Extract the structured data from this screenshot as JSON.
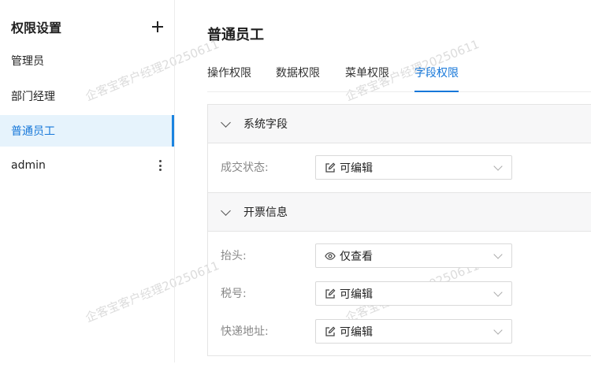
{
  "sidebar": {
    "title": "权限设置",
    "add_icon": "plus-icon",
    "items": [
      {
        "label": "管理员",
        "active": false
      },
      {
        "label": "部门经理",
        "active": false
      },
      {
        "label": "普通员工",
        "active": true
      },
      {
        "label": "admin",
        "active": false,
        "more_icon": "more-vertical-icon"
      }
    ]
  },
  "main": {
    "title": "普通员工",
    "tabs": [
      {
        "label": "操作权限",
        "active": false
      },
      {
        "label": "数据权限",
        "active": false
      },
      {
        "label": "菜单权限",
        "active": false
      },
      {
        "label": "字段权限",
        "active": true
      }
    ],
    "sections": [
      {
        "title": "系统字段",
        "fields": [
          {
            "label": "成交状态:",
            "value": "可编辑",
            "icon": "edit-icon"
          }
        ]
      },
      {
        "title": "开票信息",
        "fields": [
          {
            "label": "抬头:",
            "value": "仅查看",
            "icon": "eye-icon"
          },
          {
            "label": "税号:",
            "value": "可编辑",
            "icon": "edit-icon"
          },
          {
            "label": "快递地址:",
            "value": "可编辑",
            "icon": "edit-icon"
          }
        ]
      }
    ]
  },
  "watermark": {
    "text": "企客宝客户经理20250611"
  },
  "colors": {
    "accent": "#1677d9",
    "active_bg": "#e6f3fc",
    "section_bg": "#f7f7f8"
  }
}
